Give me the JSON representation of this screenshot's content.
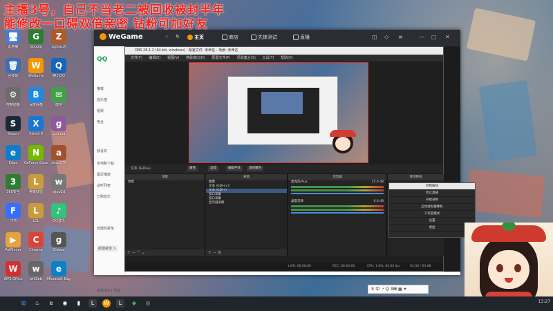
{
  "banner": {
    "line1": "主播3号，自己不当老二被回收被封半年",
    "line2": "能修改一口碍双倍亲密 钻粉可加好友"
  },
  "desktop_icons": [
    {
      "label": "此电脑",
      "glyph": "🖥"
    },
    {
      "label": "Google",
      "glyph": "G"
    },
    {
      "label": "zgjbwuX",
      "glyph": "Z"
    },
    {
      "label": "回收站",
      "glyph": "🗑"
    },
    {
      "label": "WeGame",
      "glyph": "W"
    },
    {
      "label": "腾讯QQ",
      "glyph": "Q"
    },
    {
      "label": "控制面板",
      "glyph": "⚙"
    },
    {
      "label": "百度网盘",
      "glyph": "B"
    },
    {
      "label": "微信",
      "glyph": "✉"
    },
    {
      "label": "Steam",
      "glyph": "S"
    },
    {
      "label": "Xshell 8",
      "glyph": "X"
    },
    {
      "label": "gouhua",
      "glyph": "g"
    },
    {
      "label": "Edge",
      "glyph": "e"
    },
    {
      "label": "GeForce Experience",
      "glyph": "N"
    },
    {
      "label": "abcd279",
      "glyph": "a"
    },
    {
      "label": "360安全",
      "glyph": "3"
    },
    {
      "label": "英雄联盟",
      "glyph": "L"
    },
    {
      "label": "wjgb2d",
      "glyph": "w"
    },
    {
      "label": "飞书",
      "glyph": "F"
    },
    {
      "label": "LOL",
      "glyph": "L"
    },
    {
      "label": "QQ音乐",
      "glyph": "♪"
    },
    {
      "label": "PotPlayer",
      "glyph": "▶"
    },
    {
      "label": "Chrome",
      "glyph": "C"
    },
    {
      "label": "Gidoso",
      "glyph": "g"
    },
    {
      "label": "WPS Office",
      "glyph": "W"
    },
    {
      "label": "wifi2eb",
      "glyph": "w"
    },
    {
      "label": "Microsoft Edge",
      "glyph": "e"
    }
  ],
  "wegame": {
    "logo": "WeGame",
    "nav": [
      {
        "label": "主页"
      },
      {
        "label": "商店"
      },
      {
        "label": "先锋测试"
      },
      {
        "label": "直播"
      }
    ],
    "side_title": "QQ",
    "side_items": [
      "推荐",
      "音乐馆",
      "视频",
      "电台",
      "我喜欢",
      "本地和下载",
      "最近播放",
      "试听列表",
      "已购音乐"
    ],
    "side_lower": [
      "创建的歌单",
      "新建歌单 >"
    ],
    "footer_left": "播放ING | 热歌"
  },
  "obs": {
    "title": "OBS 28.1.2 (64-bit, windows) - 配置文件: 未命名 - 场景: 未命名",
    "menu": [
      "文件(F)",
      "编辑(E)",
      "视图(V)",
      "停靠窗口(D)",
      "配置文件(P)",
      "场景集合(S)",
      "工具(T)",
      "帮助(H)"
    ],
    "toolbar_source": "文本 (GDI+)",
    "toolbar_buttons": [
      "属性",
      "滤镜",
      "编辑字体",
      "源的属性"
    ],
    "docks": {
      "scenes": {
        "title": "场景",
        "items": [
          "场景"
        ]
      },
      "sources": {
        "title": "来源",
        "items": [
          "图像",
          "文本 (GDI+) 2",
          "文本 (GDI+)",
          "窗口采集",
          "窗口采集",
          "显示器采集"
        ]
      },
      "audio": {
        "title": "混音器",
        "tracks": [
          {
            "name": "麦克风/Aux",
            "db": "25.0 dB"
          },
          {
            "name": "桌面音频",
            "db": "0.0 dB"
          }
        ]
      },
      "transition": {
        "title": "转场特效"
      },
      "controls": {
        "title": "控制按钮"
      }
    },
    "context_menu": [
      "控制按钮",
      "停止直播",
      "开始录制",
      "启动虚拟摄像机",
      "工作室模式",
      "设置",
      "退出"
    ],
    "status": {
      "live": "LIVE: 00:00:00",
      "rec": "REC: 00:00:00",
      "cpu": "CPU: 1.8%, 60.00 fps",
      "time": "01:36 / 03:08"
    }
  },
  "ime": {
    "label": "中"
  },
  "tray": {
    "time": "13:27"
  },
  "colors": {
    "banner": "#f2241d",
    "wegame_bar": "#2b2d33",
    "obs_bg": "#1f1f1f",
    "accent": "#f39800"
  }
}
